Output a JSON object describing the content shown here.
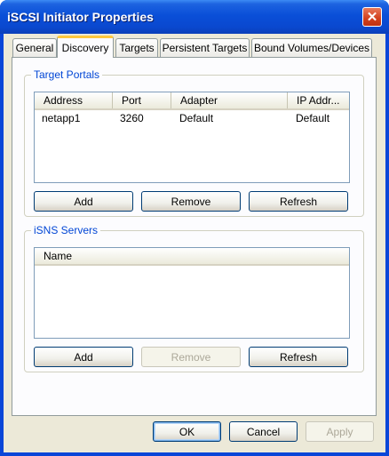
{
  "window": {
    "title": "iSCSI Initiator Properties",
    "close_glyph": "✕"
  },
  "tabs": [
    {
      "label": "General"
    },
    {
      "label": "Discovery",
      "active": true
    },
    {
      "label": "Targets"
    },
    {
      "label": "Persistent Targets"
    },
    {
      "label": "Bound Volumes/Devices"
    }
  ],
  "target_portals": {
    "group_label": "Target Portals",
    "columns": [
      "Address",
      "Port",
      "Adapter",
      "IP Addr..."
    ],
    "rows": [
      {
        "address": "netapp1",
        "port": "3260",
        "adapter": "Default",
        "ip": "Default"
      }
    ],
    "buttons": {
      "add": "Add",
      "remove": "Remove",
      "refresh": "Refresh"
    }
  },
  "isns_servers": {
    "group_label": "iSNS Servers",
    "columns": [
      "Name"
    ],
    "buttons": {
      "add": "Add",
      "remove": "Remove",
      "refresh": "Refresh"
    },
    "remove_disabled": true
  },
  "footer": {
    "ok": "OK",
    "cancel": "Cancel",
    "apply": "Apply",
    "apply_disabled": true
  },
  "colors": {
    "titlebar": "#0a4fd8",
    "group_label": "#0046d5",
    "dialog_bg": "#ece9d8",
    "active_tab_accent": "#ffc83c"
  }
}
